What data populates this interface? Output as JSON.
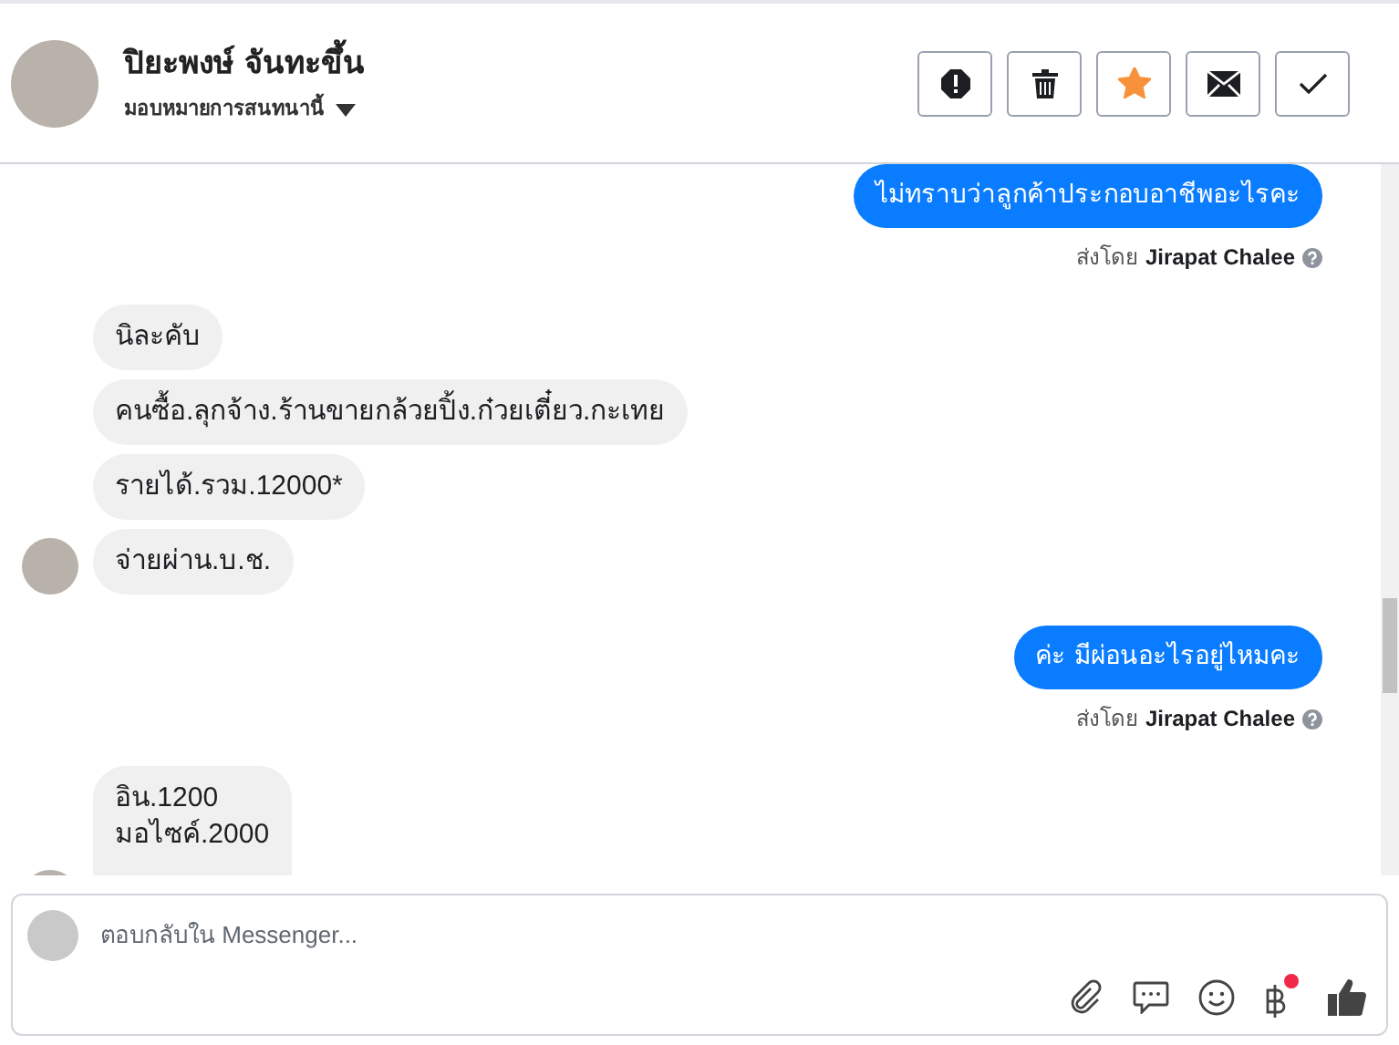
{
  "contact": {
    "name": "ปิยะพงษ์ จันทะขึ้น",
    "assign_label": "มอบหมายการสนทนานี้"
  },
  "actions": [
    {
      "kind": "spam"
    },
    {
      "kind": "delete"
    },
    {
      "kind": "star",
      "on": true
    },
    {
      "kind": "mail"
    },
    {
      "kind": "done"
    }
  ],
  "messages": [
    {
      "kind": "outgoing",
      "text": "ไม่ทราบว่าลูกค้าประกอบอาชีพอะไรคะ",
      "sent_by": "ส่งโดย",
      "sender": "Jirapat Chalee"
    },
    {
      "kind": "incoming",
      "text": "นิละคับ",
      "avatar": false
    },
    {
      "kind": "incoming",
      "text": "คนซื้อ.ลุกจ้าง.ร้านขายกล้วยปิ้ง.ก๋วยเตี๋ยว.กะเทย",
      "avatar": false
    },
    {
      "kind": "incoming",
      "text": "รายได้.รวม.12000*",
      "avatar": false
    },
    {
      "kind": "incoming",
      "text": "จ่ายผ่าน.บ.ช.",
      "avatar": true
    },
    {
      "kind": "outgoing",
      "text": "ค่ะ มีผ่อนอะไรอยู่ไหมคะ",
      "sent_by": "ส่งโดย",
      "sender": "Jirapat Chalee"
    },
    {
      "kind": "incoming",
      "lines": [
        "อิน.1200",
        "มอไซค์.2000"
      ],
      "avatar": true
    }
  ],
  "composer": {
    "placeholder": "ตอบกลับใน Messenger...",
    "tools": [
      {
        "kind": "attach"
      },
      {
        "kind": "saved-reply"
      },
      {
        "kind": "emoji"
      },
      {
        "kind": "payment",
        "badge": true
      },
      {
        "kind": "like"
      }
    ]
  }
}
